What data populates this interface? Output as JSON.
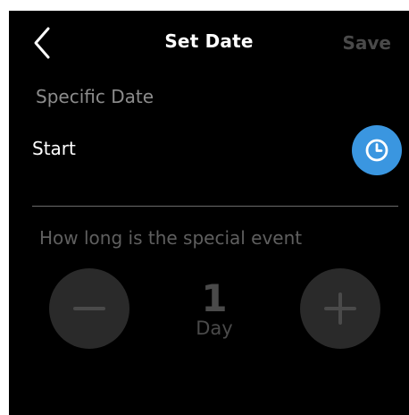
{
  "header": {
    "title": "Set Date",
    "save_label": "Save"
  },
  "section_label": "Specific Date",
  "start": {
    "label": "Start"
  },
  "duration": {
    "question": "How long is the special event",
    "value": "1",
    "unit": "Day"
  },
  "icons": {
    "back": "chevron-left-icon",
    "clock": "clock-icon",
    "minus": "minus-icon",
    "plus": "plus-icon"
  },
  "colors": {
    "background": "#000000",
    "accent": "#3a96e0",
    "disabled_text": "#4a4a4a",
    "button_fill": "#2a2a2a"
  }
}
